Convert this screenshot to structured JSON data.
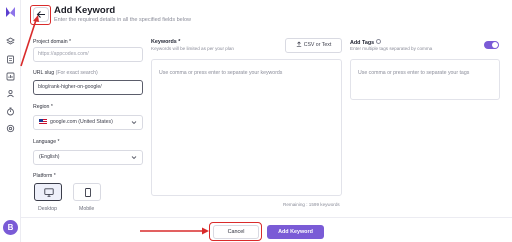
{
  "header": {
    "title": "Add Keyword",
    "subtitle": "Enter the required details in all the specified fields below"
  },
  "form": {
    "project_domain": {
      "label": "Project domain *",
      "placeholder": "https://appcodes.com/"
    },
    "url_slug": {
      "label": "URL slug",
      "hint": "(For exact search)",
      "value": "blog/rank-higher-on-google/"
    },
    "region": {
      "label": "Region *",
      "value": "google.com (United States)"
    },
    "language": {
      "label": "Language *",
      "value": "(English)"
    },
    "platform": {
      "label": "Platform *",
      "options": [
        "Desktop",
        "Mobile"
      ],
      "selected": "Desktop"
    }
  },
  "keywords": {
    "label": "Keywords *",
    "hint": "Keywords will be limited as per your plan",
    "csv_button": "CSV or Text",
    "placeholder": "Use comma or press enter to separate your keywords",
    "remaining": "Remaining : 1599 keywords"
  },
  "tags": {
    "label": "Add Tags",
    "hint": "Enter multiple tags separated by comma",
    "toggle_on": true,
    "placeholder": "Use comma or press enter to separate your tags"
  },
  "footer": {
    "cancel_label": "Cancel",
    "add_label": "Add Keyword"
  },
  "sidebar": {
    "icons": [
      "brand-logo-icon",
      "layers-icon",
      "document-icon",
      "chart-icon",
      "users-icon",
      "timer-icon",
      "settings-icon"
    ],
    "avatar_initial": "B"
  },
  "colors": {
    "accent": "#7a5bd6",
    "annotation": "#d92b2b"
  }
}
